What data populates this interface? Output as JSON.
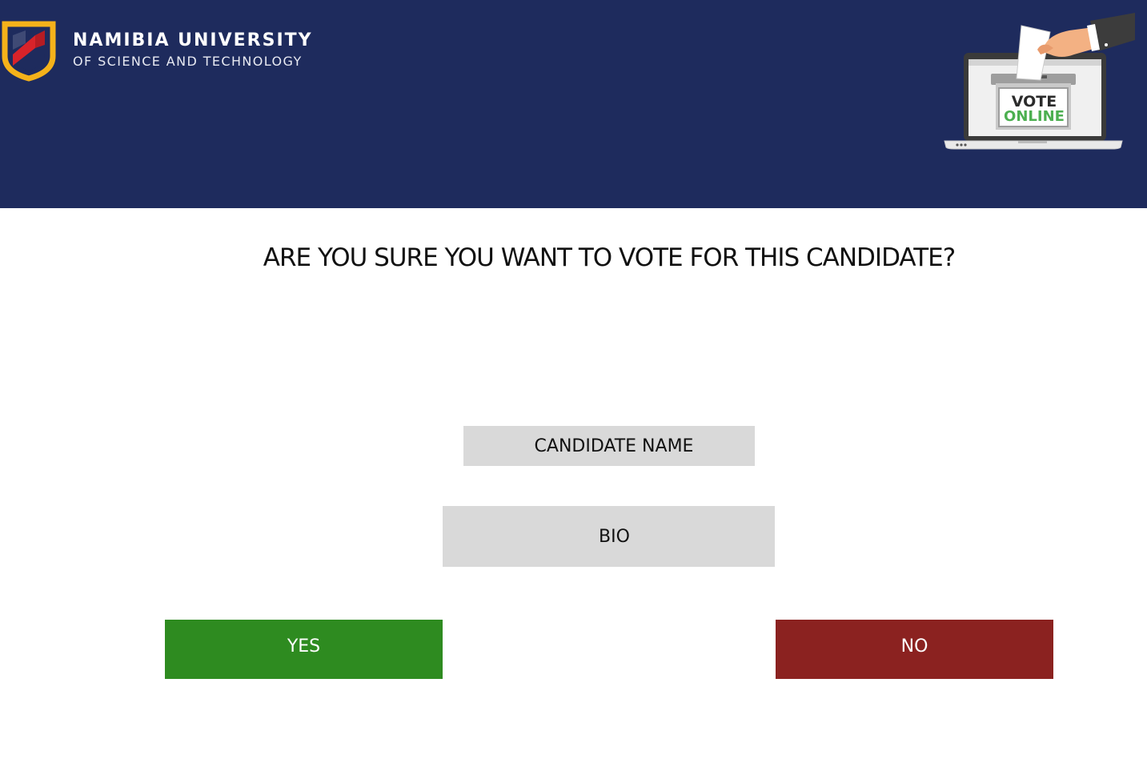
{
  "header": {
    "university_name": "NAMIBIA UNIVERSITY",
    "university_subtitle": "OF SCIENCE AND TECHNOLOGY",
    "illustration": {
      "line1": "VOTE",
      "line2": "ONLINE"
    }
  },
  "main": {
    "question": "ARE YOU SURE YOU WANT TO VOTE FOR THIS CANDIDATE?",
    "candidate_name_label": "CANDIDATE NAME",
    "bio_label": "BIO",
    "yes_label": "YES",
    "no_label": "NO"
  },
  "colors": {
    "header_bg": "#1e2b5d",
    "yes": "#2e8b20",
    "no": "#8b2220",
    "info_box": "#d9d9d9"
  }
}
